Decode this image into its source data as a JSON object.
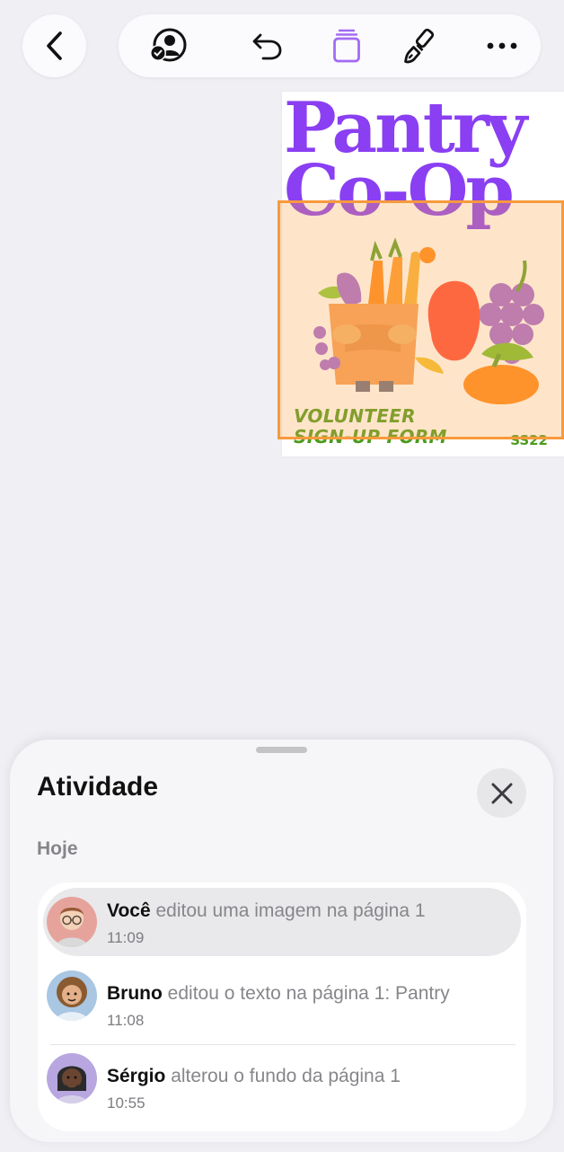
{
  "toolbar": {
    "back": "chevron-left-icon",
    "buttons": [
      "collaborate-icon",
      "undo-icon",
      "page-icon",
      "brush-icon",
      "more-icon"
    ]
  },
  "document": {
    "title": "Pantry\nCo-Op",
    "footer_line1": "VOLUNTEER",
    "footer_line2": "SIGN-UP FORM",
    "code": "SS22"
  },
  "activity": {
    "title": "Atividade",
    "section": "Hoje",
    "items": [
      {
        "user": "Você",
        "action": "editou uma imagem na página 1",
        "time": "11:09"
      },
      {
        "user": "Bruno",
        "action": "editou o texto na página 1: Pantry",
        "time": "11:08"
      },
      {
        "user": "Sérgio",
        "action": "alterou o fundo da página 1",
        "time": "10:55"
      }
    ]
  },
  "colors": {
    "accent_purple": "#8a3ff2",
    "selection_orange": "#f79a3c",
    "footer_green": "#4e9a1e"
  }
}
